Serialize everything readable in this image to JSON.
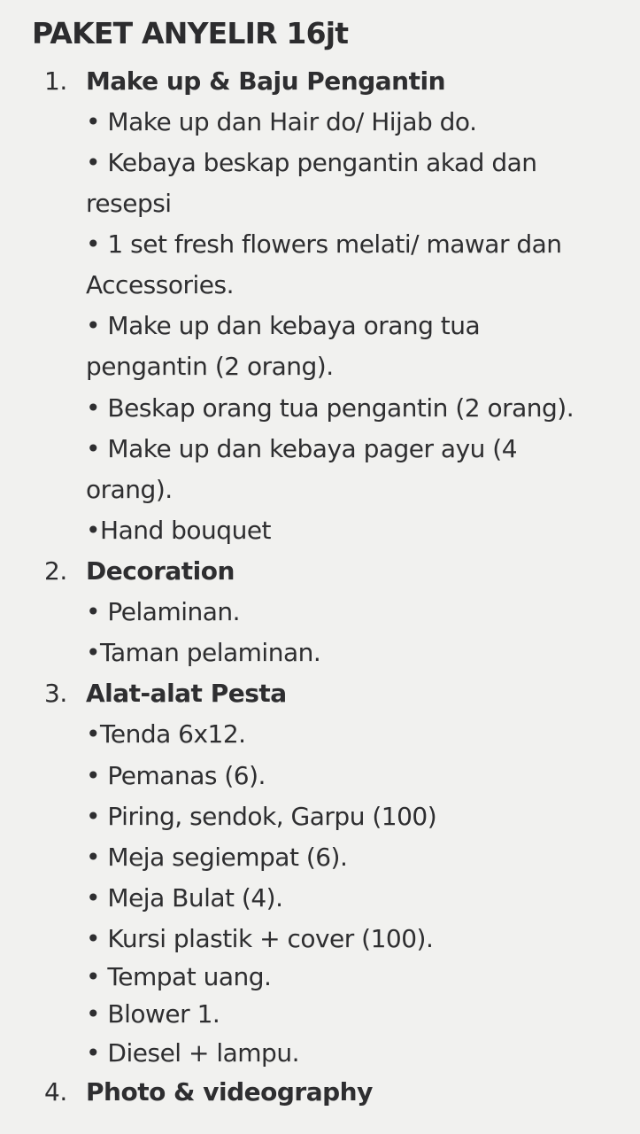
{
  "title": "PAKET ANYELIR 16jt",
  "sections": [
    {
      "number": "1.",
      "heading": "Make up & Baju Pengantin",
      "lines": [
        "• Make up dan Hair do/ Hijab do.",
        "• Kebaya beskap pengantin akad dan",
        "resepsi",
        "• 1 set fresh flowers melati/ mawar dan",
        "Accessories.",
        "• Make up dan kebaya orang tua",
        "pengantin (2 orang).",
        "• Beskap orang tua pengantin (2 orang).",
        "• Make up dan kebaya pager ayu (4",
        "orang).",
        "•Hand bouquet"
      ]
    },
    {
      "number": "2.",
      "heading": "Decoration",
      "lines": [
        "• Pelaminan.",
        "•Taman pelaminan."
      ]
    },
    {
      "number": "3.",
      "heading": "Alat-alat Pesta",
      "lines": [
        "•Tenda 6x12.",
        "• Pemanas (6).",
        "• Piring, sendok, Garpu (100)",
        "• Meja segiempat (6).",
        "• Meja Bulat (4).",
        "• Kursi plastik + cover (100).",
        "• Tempat uang.",
        "• Blower 1.",
        "• Diesel + lampu."
      ]
    },
    {
      "number": "4.",
      "heading": "Photo & videography",
      "lines": []
    }
  ]
}
